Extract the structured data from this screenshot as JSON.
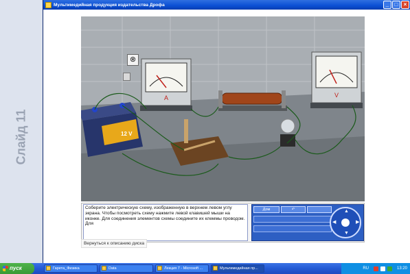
{
  "slide": {
    "label": "Слайд 11"
  },
  "window": {
    "title": "Мультимедийная продукция издательства Дрофа",
    "buttons": {
      "minimize": "_",
      "maximize": "□",
      "close": "×"
    }
  },
  "scene": {
    "ammeter_label": "A",
    "voltmeter_label": "V",
    "battery_label": "12 V"
  },
  "instructions": {
    "text": "Соберите электрическую схему, изображенную в верхнем левом углу экрана. Чтобы посмотреть схему нажмите левой клавишей мыши на иконке. Для соединения элементов схемы соедините их клеммы проводом. Для"
  },
  "controls": {
    "home_label": "Дом",
    "back_label": "↶",
    "fwd_label": "",
    "nav_up": "▲",
    "nav_down": "▼",
    "nav_left": "◀",
    "nav_right": "▶"
  },
  "footer": {
    "back_link": "Вернуться к описанию диска"
  },
  "taskbar": {
    "start": "пуск",
    "tasks": [
      {
        "label": "Гарета_Физика",
        "active": false
      },
      {
        "label": "Data",
        "active": false
      },
      {
        "label": "Лекция 7 - Microsoft ...",
        "active": false
      },
      {
        "label": "Мультимедийная пр...",
        "active": true
      }
    ],
    "lang": "RU",
    "time": "13:20"
  },
  "colors": {
    "titlebar": "#0a4fd4",
    "taskbar": "#245ad4",
    "start": "#3a9a35",
    "wire": "#1a5a1a",
    "coil": "#a0451a",
    "battery_blue": "#27356b",
    "battery_yellow": "#e8a81a"
  }
}
